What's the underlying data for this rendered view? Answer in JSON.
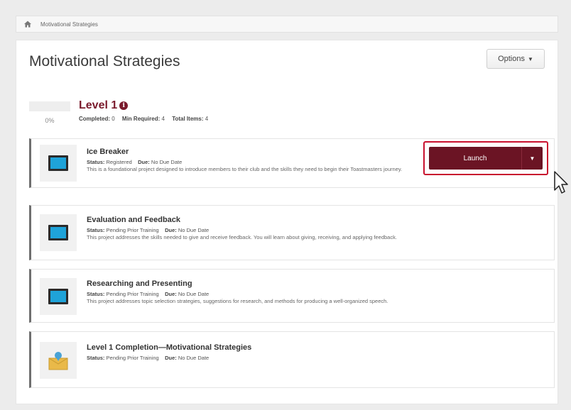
{
  "breadcrumb": {
    "current": "Motivational Strategies"
  },
  "header": {
    "title": "Motivational Strategies",
    "options_label": "Options"
  },
  "level": {
    "progress_percent": 0,
    "progress_label": "0%",
    "title": "Level 1",
    "completed_label": "Completed:",
    "completed_value": "0",
    "min_required_label": "Min Required:",
    "min_required_value": "4",
    "total_items_label": "Total Items:",
    "total_items_value": "4"
  },
  "items": [
    {
      "title": "Ice Breaker",
      "status_label": "Status:",
      "status": "Registered",
      "due_label": "Due:",
      "due": "No Due Date",
      "desc": "This is a foundational project designed to introduce members to their club and the skills they need to begin their Toastmasters journey.",
      "action_label": "Launch"
    },
    {
      "title": "Evaluation and Feedback",
      "status_label": "Status:",
      "status": "Pending Prior Training",
      "due_label": "Due:",
      "due": "No Due Date",
      "desc": "This project addresses the skills needed to give and receive feedback. You will learn about giving, receiving, and applying feedback."
    },
    {
      "title": "Researching and Presenting",
      "status_label": "Status:",
      "status": "Pending Prior Training",
      "due_label": "Due:",
      "due": "No Due Date",
      "desc": "This project addresses topic selection strategies, suggestions for research, and methods for producing a well-organized speech."
    },
    {
      "title": "Level 1 Completion—Motivational Strategies",
      "status_label": "Status:",
      "status": "Pending Prior Training",
      "due_label": "Due:",
      "due": "No Due Date"
    }
  ],
  "colors": {
    "accent": "#7a1a2c",
    "launch": "#6b1424",
    "focus": "#c8102e",
    "monitor": "#1fa3d9"
  },
  "icons": {
    "home": "home-icon",
    "info": "info-icon",
    "project": "monitor-icon",
    "completion": "trophy-icon",
    "cursor": "mouse-pointer-icon"
  }
}
